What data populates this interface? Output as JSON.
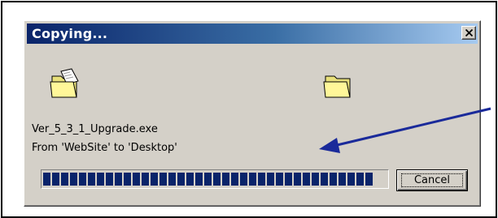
{
  "dialog": {
    "title": "Copying...",
    "close_icon": "close-x-icon",
    "source_icon": "folder-with-document-icon",
    "destination_icon": "folder-icon",
    "filename": "Ver_5_3_1_Upgrade.exe",
    "from_to": "From 'WebSite' to 'Desktop'",
    "progress_fraction": 0.98,
    "cancel_label": "Cancel"
  },
  "colors": {
    "title_gradient_start": "#0a246a",
    "title_gradient_end": "#a6caf0",
    "progress_block": "#0a246a",
    "annotation_arrow": "#1a2a9a",
    "dialog_face": "#d4d0c8"
  }
}
